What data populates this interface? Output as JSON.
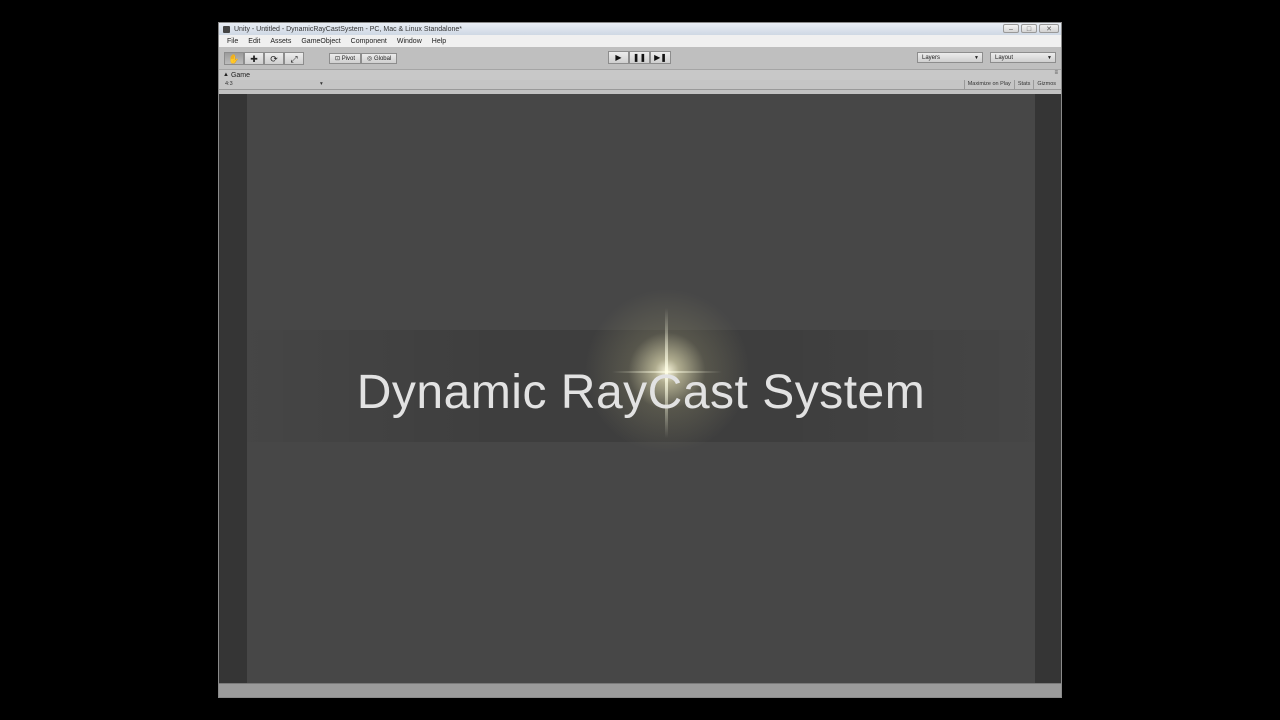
{
  "window": {
    "title": "Unity - Untitled - DynamicRayCastSystem - PC, Mac & Linux Standalone*"
  },
  "menubar": {
    "items": [
      "File",
      "Edit",
      "Assets",
      "GameObject",
      "Component",
      "Window",
      "Help"
    ]
  },
  "toolbar": {
    "pivot_label": "Pivot",
    "global_label": "Global",
    "layers_label": "Layers",
    "layout_label": "Layout"
  },
  "game_tab": {
    "label": "Game",
    "aspect_label": "4:3",
    "maximize_label": "Maximize on Play",
    "stats_label": "Stats",
    "gizmos_label": "Gizmos"
  },
  "game_view": {
    "title_text": "Dynamic RayCast System"
  },
  "colors": {
    "game_background": "#474747",
    "viewport_border": "#353535",
    "title_text": "#e2e2e2",
    "flare": "#fffbe0"
  }
}
